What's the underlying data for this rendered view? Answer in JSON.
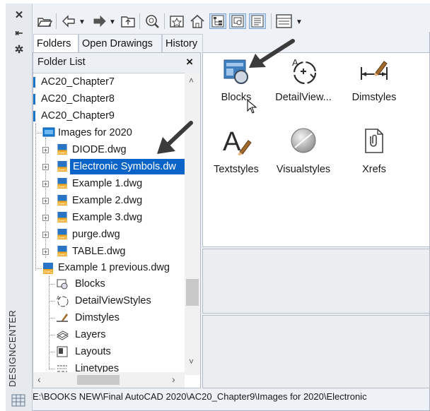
{
  "palette": {
    "label": "DESIGNCENTER",
    "close_glyph": "✕",
    "autohide_glyph": "⇤",
    "properties_glyph": "✲"
  },
  "toolbar": {
    "buttons": [
      "load-icon",
      "back-icon",
      "forward-icon",
      "up-folder-icon",
      "search-icon",
      "favorites-icon",
      "home-icon",
      "tree-view-toggle-icon",
      "preview-icon",
      "description-icon",
      "views-icon"
    ]
  },
  "tabs": [
    {
      "label": "Folders",
      "active": true
    },
    {
      "label": "Open Drawings",
      "active": false
    },
    {
      "label": "History",
      "active": false
    }
  ],
  "tree": {
    "header": "Folder List",
    "close": "×",
    "rows": [
      {
        "label": "AC20_Chapter7",
        "kind": "folder"
      },
      {
        "label": "AC20_Chapter8",
        "kind": "folder"
      },
      {
        "label": "AC20_Chapter9",
        "kind": "folder"
      },
      {
        "label": "Images for 2020",
        "kind": "folder-open"
      },
      {
        "label": "DIODE.dwg",
        "kind": "dwg"
      },
      {
        "label": "Electronic Symbols.dw",
        "kind": "dwg",
        "selected": true
      },
      {
        "label": "Example 1.dwg",
        "kind": "dwg"
      },
      {
        "label": "Example 2.dwg",
        "kind": "dwg"
      },
      {
        "label": "Example 3.dwg",
        "kind": "dwg"
      },
      {
        "label": "purge.dwg",
        "kind": "dwg"
      },
      {
        "label": "TABLE.dwg",
        "kind": "dwg"
      },
      {
        "label": "Example 1 previous.dwg",
        "kind": "dwg-open"
      },
      {
        "label": "Blocks",
        "kind": "child"
      },
      {
        "label": "DetailViewStyles",
        "kind": "child"
      },
      {
        "label": "Dimstyles",
        "kind": "child"
      },
      {
        "label": "Layers",
        "kind": "child"
      },
      {
        "label": "Layouts",
        "kind": "child"
      },
      {
        "label": "Linetypes",
        "kind": "child"
      }
    ]
  },
  "content": {
    "items": [
      {
        "label": "Blocks",
        "icon": "blocks-icon"
      },
      {
        "label": "DetailView...",
        "icon": "detail-view-icon"
      },
      {
        "label": "Dimstyles",
        "icon": "dimstyles-icon"
      },
      {
        "label": "Textstyles",
        "icon": "textstyles-icon"
      },
      {
        "label": "Visualstyles",
        "icon": "visualstyles-icon"
      },
      {
        "label": "Xrefs",
        "icon": "xrefs-icon"
      }
    ]
  },
  "status": {
    "path": "E:\\BOOKS NEW\\Final AutoCAD 2020\\AC20_Chapter9\\Images for 2020\\Electronic"
  },
  "colors": {
    "selection": "#0a64c8",
    "annotation_arrow": "#3b3b3b"
  }
}
